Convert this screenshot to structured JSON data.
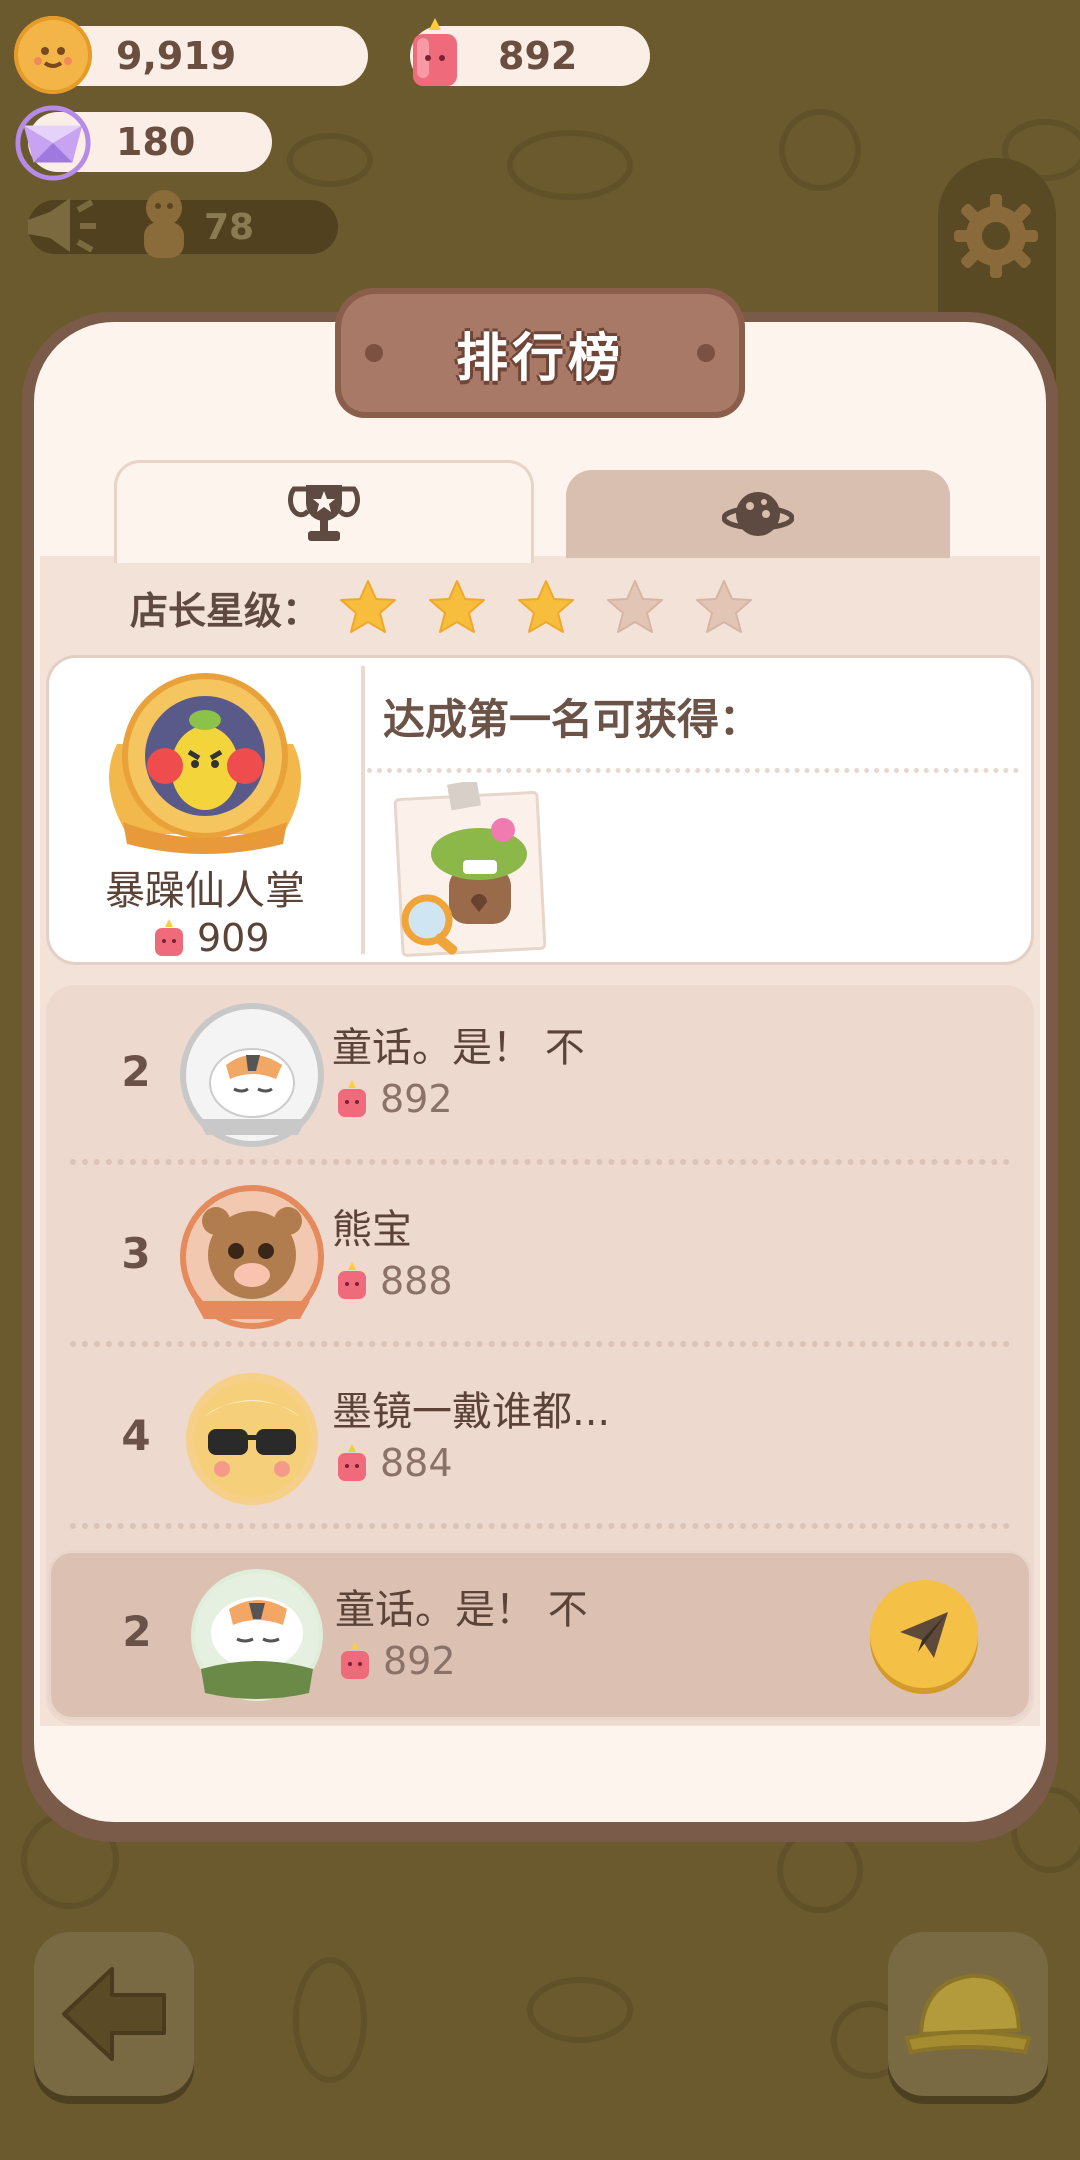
{
  "resources": {
    "cookies": "9,919",
    "candles": "892",
    "gems": "180",
    "helpers": "78"
  },
  "dialog": {
    "title": "排行榜",
    "tabs": [
      {
        "icon": "trophy-icon",
        "active": true
      },
      {
        "icon": "planet-icon",
        "active": false
      }
    ],
    "star_label": "店长星级：",
    "star_rating": {
      "filled": 3,
      "total": 5
    }
  },
  "top_player": {
    "name": "暴躁仙人掌",
    "score": "909",
    "reward_title": "达成第一名可获得："
  },
  "ranking": [
    {
      "rank": "2",
      "name": "童话。是！ 不",
      "score": "892"
    },
    {
      "rank": "3",
      "name": "熊宝",
      "score": "888"
    },
    {
      "rank": "4",
      "name": "墨镜一戴谁都...",
      "score": "884"
    }
  ],
  "self": {
    "rank": "2",
    "name": "童话。是！ 不",
    "score": "892"
  },
  "colors": {
    "background": "#6b5a2e",
    "dialog": "#fdf4ee",
    "accent": "#f5c046",
    "title_plate": "#a77966"
  }
}
